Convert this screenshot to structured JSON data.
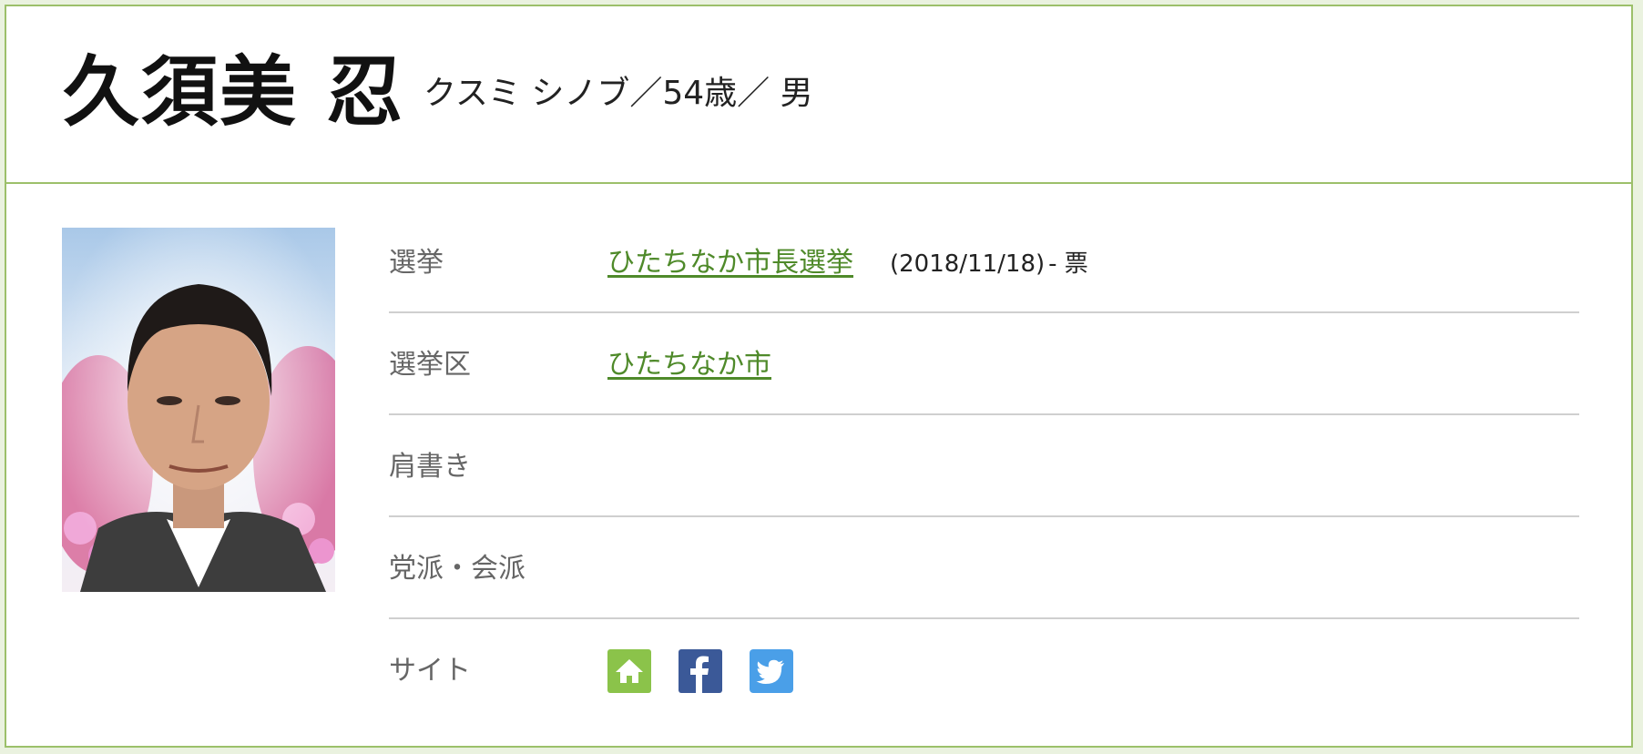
{
  "profile": {
    "name": "久須美 忍",
    "kana_age_gender": "クスミ シノブ／54歳／ 男"
  },
  "details": [
    {
      "label": "選挙",
      "value": "ひたちなか市長選挙",
      "date": "(2018/11/18)",
      "votes": "- 票"
    },
    {
      "label": "選挙区",
      "value": "ひたちなか市"
    },
    {
      "label": "肩書き",
      "value": ""
    },
    {
      "label": "党派・会派",
      "value": ""
    },
    {
      "label": "サイト",
      "icons": [
        "home-icon",
        "facebook-icon",
        "twitter-icon"
      ]
    }
  ],
  "colors": {
    "accent_border": "#9cc06a",
    "link": "#4f8a2a",
    "home": "#8bc34a",
    "facebook": "#3b5998",
    "twitter": "#4a9fe8"
  }
}
